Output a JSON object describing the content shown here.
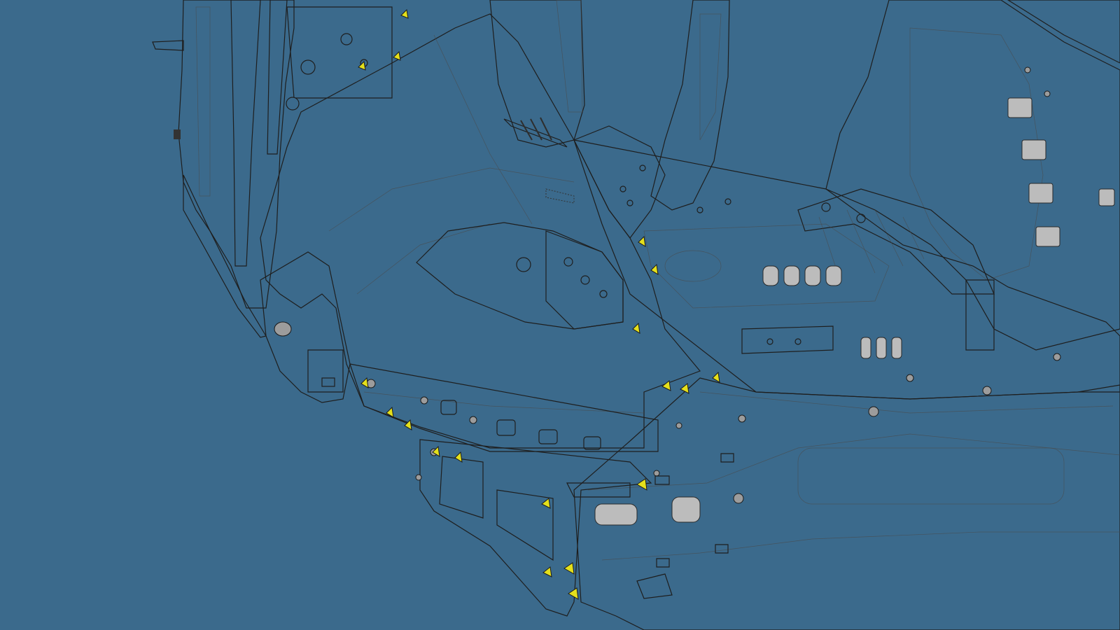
{
  "scene": {
    "background_color": "#3b6a8c",
    "light_panel_color": "#c9c9c9",
    "light_panel_shade": "#b2b2b2",
    "dark_panel_color": "#6c6c6c",
    "dark_panel_shade": "#5a5a5a",
    "marker_color": "#e4e01c",
    "marker_icon": "weld-point-triangle-icon"
  }
}
